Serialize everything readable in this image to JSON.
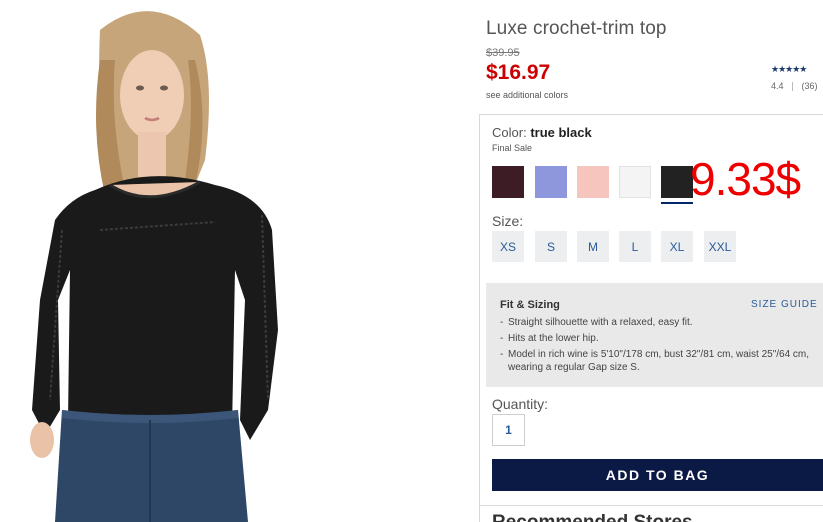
{
  "product": {
    "title": "Luxe crochet-trim top",
    "was_price": "$39.95",
    "sale_price": "$16.97",
    "see_colors": "see additional colors",
    "rating": {
      "stars_glyph": "★★★★★",
      "score": "4.4",
      "count": "(36)"
    }
  },
  "color": {
    "label": "Color:",
    "selected": "true black",
    "final_sale": "Final Sale",
    "swatches": [
      {
        "name": "rich wine",
        "hex": "#3e1c26"
      },
      {
        "name": "periwinkle",
        "hex": "#8e97dc"
      },
      {
        "name": "pink",
        "hex": "#f6c5be"
      },
      {
        "name": "white",
        "hex": "#f4f4f4"
      },
      {
        "name": "true black",
        "hex": "#222222",
        "selected": true
      }
    ]
  },
  "overlay_price": "9.33$",
  "size": {
    "label": "Size:",
    "options": [
      "XS",
      "S",
      "M",
      "L",
      "XL",
      "XXL"
    ]
  },
  "fit": {
    "title": "Fit & Sizing",
    "size_guide": "SIZE GUIDE",
    "bullets": [
      "Straight silhouette with a relaxed, easy fit.",
      "Hits at the lower hip.",
      "Model in rich wine is 5'10\"/178 cm, bust 32\"/81 cm, waist 25\"/64 cm, wearing a regular Gap size S."
    ]
  },
  "quantity": {
    "label": "Quantity:",
    "value": "1"
  },
  "add_to_bag": "ADD TO BAG",
  "cutoff_text": "Recommended Stores",
  "colors": {
    "sale_red": "#cc0000",
    "navy": "#0b1a45",
    "link_blue": "#2a5a9a",
    "overlay_red": "#ee0000"
  }
}
